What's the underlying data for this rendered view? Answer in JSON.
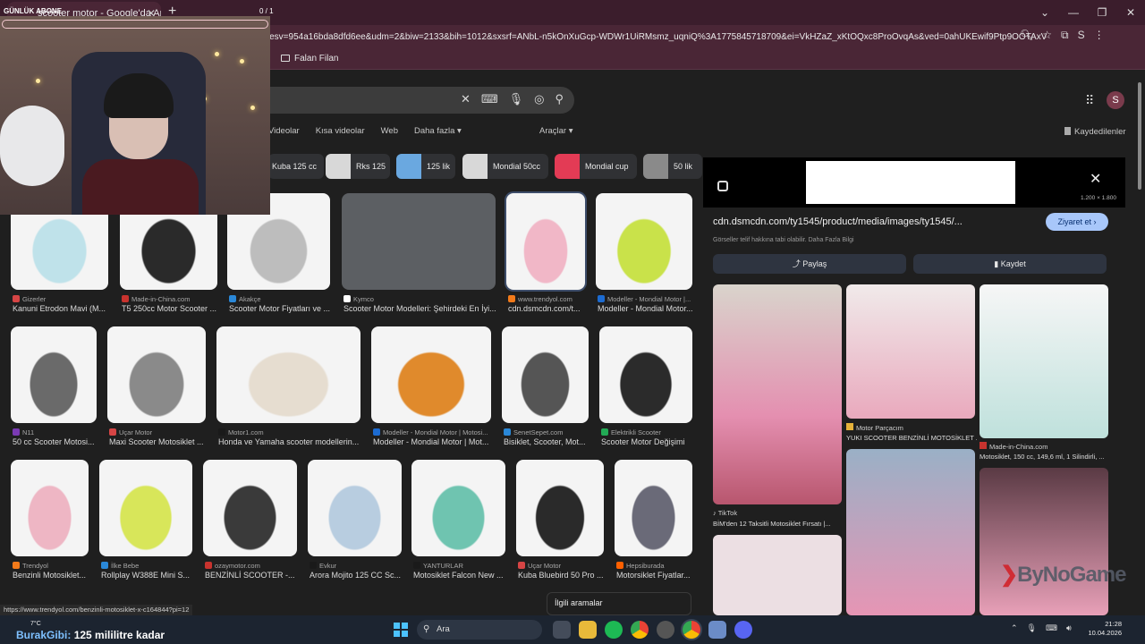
{
  "browser": {
    "tab_title": "scooter motor - Google'da Ara",
    "url": "a_esv=954a16bda8dfd6ee&udm=2&biw=2133&bih=1012&sxsrf=ANbL-n5kOnXuGcp-WDWr1UiRMsmz_uqniQ%3A1775845718709&ei=VkHZaZ_xKtOQxc8ProOvqAs&ved=0ahUKEwif9Ptp9OOTAxVTSP...",
    "bookmark": "Falan Filan",
    "profile_letter": "S"
  },
  "stream_overlay": {
    "label": "GÜNLÜK ABONE",
    "count": "0 / 1"
  },
  "search": {
    "tabs": [
      "Videolar",
      "Kısa videolar",
      "Web",
      "Daha fazla"
    ],
    "tools": "Araçlar",
    "saved": "Kaydedilenler",
    "chips": [
      "Kuba 125 cc",
      "Rks 125",
      "125 lik",
      "Mondial 50cc",
      "Mondial cup",
      "50 lik"
    ]
  },
  "results": [
    {
      "source": "Gizerler",
      "caption": "Kanuni Etrodon Mavi (M...",
      "fav": "#d64545",
      "tone": "#bfe2ea"
    },
    {
      "source": "Made-in-China.com",
      "caption": "T5 250cc Motor Scooter ...",
      "fav": "#c8332e",
      "tone": "#2a2a2a"
    },
    {
      "source": "Akakçe",
      "caption": "Scooter Motor Fiyatları ve ...",
      "fav": "#2a88d8",
      "tone": "#bdbdbd"
    },
    {
      "source": "Kymco",
      "caption": "Scooter Motor Modelleri: Şehirdeki En İyi...",
      "fav": "#ffffff",
      "tone": "#5c5f63"
    },
    {
      "source": "www.trendyol.com",
      "caption": "cdn.dsmcdn.com/t...",
      "fav": "#f27a1a",
      "tone": "#f1b7c7"
    },
    {
      "source": "Modeller - Mondial Motor |...",
      "caption": "Modeller - Mondial Motor...",
      "fav": "#1c6bd1",
      "tone": "#c9e24a"
    },
    {
      "source": "N11",
      "caption": "50 cc Scooter Motosi...",
      "fav": "#7a3ab3",
      "tone": "#6a6a6a"
    },
    {
      "source": "Uçar Motor",
      "caption": "Maxi Scooter Motosiklet ...",
      "fav": "#d64545",
      "tone": "#8a8a8a"
    },
    {
      "source": "Motor1.com",
      "caption": "Honda ve Yamaha scooter modellerin...",
      "fav": "#1a1a1a",
      "tone": "#e6ddd0"
    },
    {
      "source": "Modeller - Mondial Motor | Motosi...",
      "caption": "Modeller - Mondial Motor | Mot...",
      "fav": "#1c6bd1",
      "tone": "#e08a2c"
    },
    {
      "source": "SenetSepet.com",
      "caption": "Bisiklet, Scooter, Mot...",
      "fav": "#2a88d8",
      "tone": "#555555"
    },
    {
      "source": "Elektrikli Scooter",
      "caption": "Scooter Motor Değişimi",
      "fav": "#22aa55",
      "tone": "#2b2b2b"
    },
    {
      "source": "Trendyol",
      "caption": "Benzinli Motosiklet...",
      "fav": "#f27a1a",
      "tone": "#eeb6c4"
    },
    {
      "source": "İlke Bebe",
      "caption": "Rollplay W388E Mini S...",
      "fav": "#2a88d8",
      "tone": "#d8e65a"
    },
    {
      "source": "ozaymotor.com",
      "caption": "BENZİNLİ SCOOTER -...",
      "fav": "#c8332e",
      "tone": "#3a3a3a"
    },
    {
      "source": "Evkur",
      "caption": "Arora Mojito 125 CC Sc...",
      "fav": "#1a1a1a",
      "tone": "#b8cde0"
    },
    {
      "source": "YANTURLAR",
      "caption": "Motosiklet Falcon New ...",
      "fav": "#1a1a1a",
      "tone": "#6fc4b0"
    },
    {
      "source": "Uçar Motor",
      "caption": "Kuba Bluebird 50 Pro ...",
      "fav": "#d64545",
      "tone": "#2a2a2a"
    },
    {
      "source": "Hepsiburada",
      "caption": "Motorsiklet Fiyatlar...",
      "fav": "#ff6000",
      "tone": "#6a6a78"
    }
  ],
  "related_searches": "İlgili aramalar",
  "panel": {
    "url": "cdn.dsmcdn.com/ty1545/product/media/images/ty1545/...",
    "dims": "1.200 × 1.800",
    "visit": "Ziyaret et",
    "copyright": "Görseller telif hakkına tabi olabilir. Daha Fazla Bilgi",
    "share": "Paylaş",
    "save": "Kaydet",
    "related": [
      {
        "source": "TikTok",
        "caption": "BİM'den 12 Taksitli Motosiklet Fırsatı |..."
      },
      {
        "source": "Motor Parçacım",
        "caption": "YUKI SCOOTER BENZİNLİ MOTOSİKLET ..."
      },
      {
        "source": "Made-in-China.com",
        "caption": "Motosiklet, 150 cc, 149,6 ml, 1 Silindirli, ..."
      }
    ]
  },
  "status_url": "https://www.trendyol.com/benzinli-motosiklet-x-c164844?pi=12",
  "taskbar": {
    "temp": "7°C",
    "ticker_prefix": "BurakGibi:",
    "ticker": "125 mililitre kadar",
    "search": "Ara",
    "time": "21:28",
    "date": "10.04.2026"
  },
  "watermark": "ByNoGame",
  "colors": {
    "accent": "#a8c7fa",
    "chrome": "#4a2636"
  }
}
